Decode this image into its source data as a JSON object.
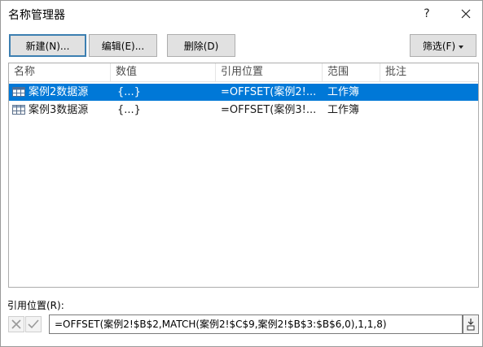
{
  "window": {
    "title": "名称管理器",
    "help_label": "?"
  },
  "toolbar": {
    "new_label": "新建(N)...",
    "edit_label": "编辑(E)...",
    "delete_label": "删除(D)",
    "filter_label": "筛选(F)"
  },
  "table": {
    "columns": [
      "名称",
      "数值",
      "引用位置",
      "范围",
      "批注"
    ],
    "rows": [
      {
        "name": "案例2数据源",
        "value": "{...}",
        "ref": "=OFFSET(案例2!...",
        "scope": "工作簿",
        "comment": "",
        "selected": true
      },
      {
        "name": "案例3数据源",
        "value": "{...}",
        "ref": "=OFFSET(案例3!...",
        "scope": "工作簿",
        "comment": "",
        "selected": false
      }
    ]
  },
  "reference": {
    "label": "引用位置(R):",
    "formula": "=OFFSET(案例2!$B$2,MATCH(案例2!$C$9,案例2!$B$3:$B$6,0),1,1,8)"
  },
  "colors": {
    "selection": "#0078d7",
    "default_button_border": "#3c7fb1"
  },
  "icons": {
    "name_row_icon": "table-grid-icon",
    "cancel": "x-icon",
    "confirm": "checkmark-icon",
    "collapse": "collapse-dialog-icon"
  }
}
